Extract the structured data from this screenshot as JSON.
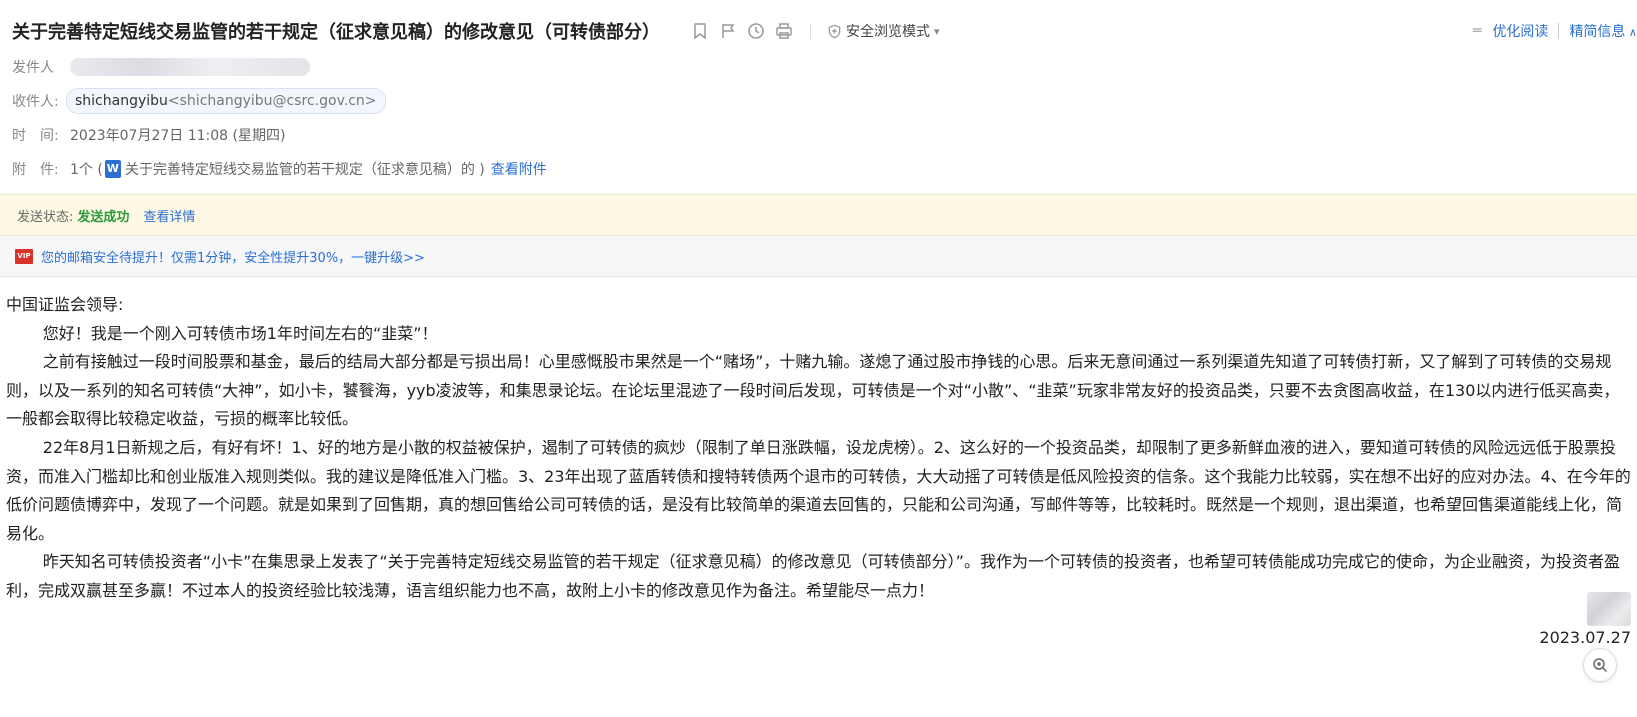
{
  "mail": {
    "subject": "关于完善特定短线交易监管的若干规定（征求意见稿）的修改意见（可转债部分）",
    "safe_mode_label": "安全浏览模式",
    "optimize_read": "优化阅读",
    "compact_info": "精简信息",
    "sender_label": "发件人",
    "recipient_label": "收件人:",
    "recipient_name": "shichangyibu",
    "recipient_email": "<shichangyibu@csrc.gov.cn>",
    "time_label": "时　间:",
    "time_value": "2023年07月27日 11:08 (星期四)",
    "attach_label": "附　件:",
    "attach_count": "1个 (",
    "attach_icon_letter": "W",
    "attach_name": "关于完善特定短线交易监管的若干规定（征求意见稿）的 )",
    "attach_link": "查看附件"
  },
  "status": {
    "label": "发送状态:",
    "value": "发送成功",
    "detail_link": "查看详情"
  },
  "vip": {
    "badge": "VIP",
    "text": "您的邮箱安全待提升！仅需1分钟，安全性提升30%，一键升级>>"
  },
  "body": {
    "greeting": "中国证监会领导:",
    "p1": "您好！我是一个刚入可转债市场1年时间左右的“韭菜”！",
    "p2": "之前有接触过一段时间股票和基金，最后的结局大部分都是亏损出局！心里感慨股市果然是一个“赌场”，十赌九输。遂熄了通过股市挣钱的心思。后来无意间通过一系列渠道先知道了可转债打新，又了解到了可转债的交易规则，以及一系列的知名可转债“大神”，如小卡，饕餮海，yyb凌波等，和集思录论坛。在论坛里混迹了一段时间后发现，可转债是一个对“小散”、“韭菜”玩家非常友好的投资品类，只要不去贪图高收益，在130以内进行低买高卖，一般都会取得比较稳定收益，亏损的概率比较低。",
    "p3": "22年8月1日新规之后，有好有坏！1、好的地方是小散的权益被保护，遏制了可转债的疯炒（限制了单日涨跌幅，设龙虎榜）。2、这么好的一个投资品类，却限制了更多新鲜血液的进入，要知道可转债的风险远远低于股票投资，而准入门槛却比和创业版准入规则类似。我的建议是降低准入门槛。3、23年出现了蓝盾转债和搜特转债两个退市的可转债，大大动摇了可转债是低风险投资的信条。这个我能力比较弱，实在想不出好的应对办法。4、在今年的低价问题债博弈中，发现了一个问题。就是如果到了回售期，真的想回售给公司可转债的话，是没有比较简单的渠道去回售的，只能和公司沟通，写邮件等等，比较耗时。既然是一个规则，退出渠道，也希望回售渠道能线上化，简易化。",
    "p4": "昨天知名可转债投资者“小卡”在集思录上发表了“关于完善特定短线交易监管的若干规定（征求意见稿）的修改意见（可转债部分）”。我作为一个可转债的投资者，也希望可转债能成功完成它的使命，为企业融资，为投资者盈利，完成双赢甚至多赢！不过本人的投资经验比较浅薄，语言组织能力也不高，故附上小卡的修改意见作为备注。希望能尽一点力！",
    "sign_date": "2023.07.27"
  },
  "icons": {
    "bookmark": "bookmark-icon",
    "flag": "flag-icon",
    "clock": "clock-icon",
    "print": "print-icon",
    "shield": "shield-icon",
    "zoom": "zoom-in-icon"
  }
}
